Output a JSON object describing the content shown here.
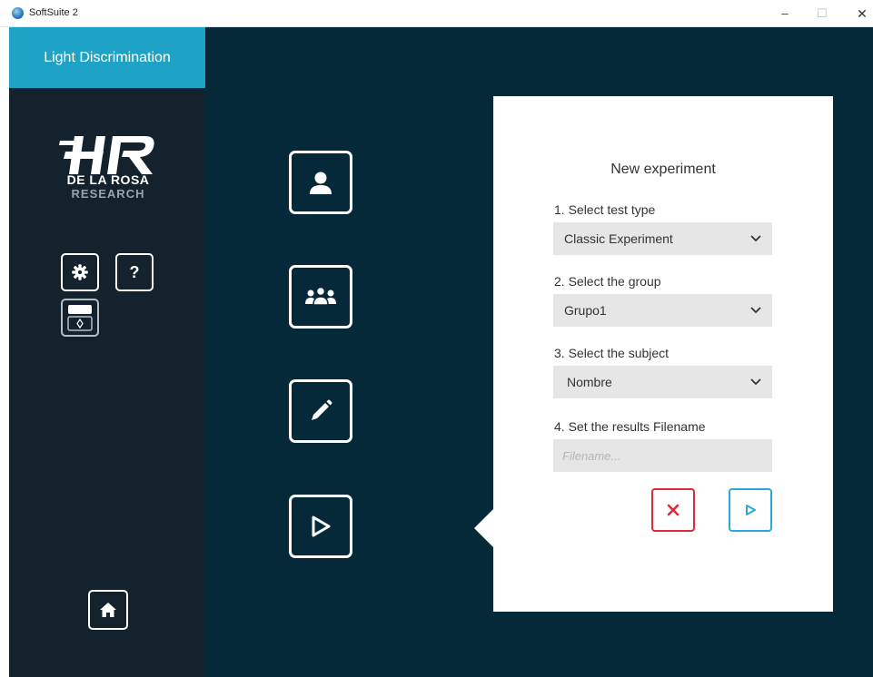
{
  "window": {
    "title": "SoftSuite 2",
    "minimize_glyph": "–",
    "maximize_glyph": "☐",
    "close_glyph": "✕"
  },
  "sidebar": {
    "app_name": "Light Discrimination",
    "logo": {
      "line1": "DE LA ROSA",
      "line2": "RESEARCH"
    },
    "help_glyph": "?"
  },
  "panel": {
    "title": "New experiment",
    "fields": {
      "test_type": {
        "label": "1. Select test type",
        "value": "Classic Experiment"
      },
      "group": {
        "label": "2. Select the group",
        "value": "Grupo1"
      },
      "subject": {
        "label": "3. Select the subject",
        "value": "Nombre"
      },
      "filename": {
        "label": "4. Set the results Filename",
        "value": "",
        "placeholder": "Filename..."
      }
    }
  },
  "colors": {
    "accent": "#1ea3c7",
    "sidebar_bg": "#13222c",
    "main_bg": "#052939",
    "cancel": "#e02a3a",
    "start": "#2aa8d8"
  },
  "icons": [
    "app-icon",
    "settings-icon",
    "help-icon",
    "display-icon",
    "home-icon",
    "subject-icon",
    "group-icon",
    "pencil-icon",
    "play-icon",
    "chevron-down-icon",
    "close-icon"
  ]
}
